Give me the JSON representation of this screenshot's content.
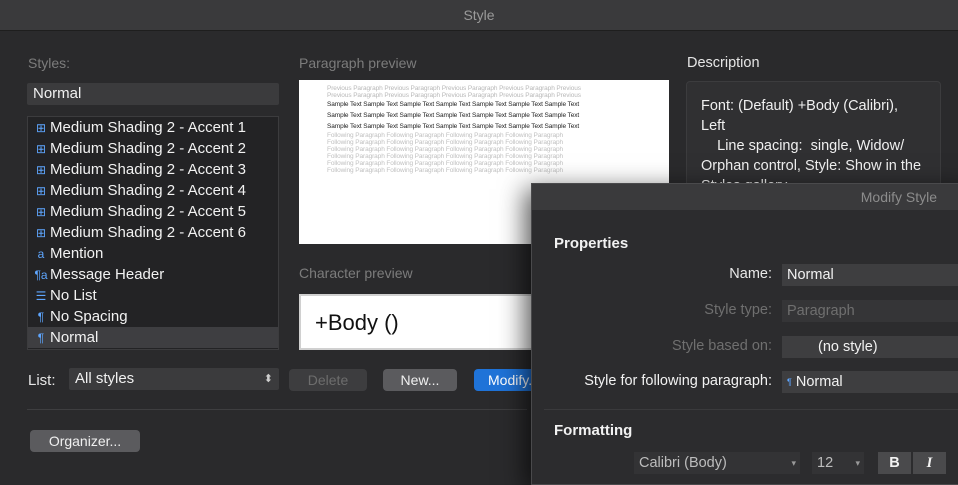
{
  "window": {
    "title": "Style"
  },
  "styles": {
    "label": "Styles:",
    "current": "Normal",
    "items": [
      {
        "icon": "⊞",
        "label": "Medium Shading 2 - Accent 1"
      },
      {
        "icon": "⊞",
        "label": "Medium Shading 2 - Accent 2"
      },
      {
        "icon": "⊞",
        "label": "Medium Shading 2 - Accent 3"
      },
      {
        "icon": "⊞",
        "label": "Medium Shading 2 - Accent 4"
      },
      {
        "icon": "⊞",
        "label": "Medium Shading 2 - Accent 5"
      },
      {
        "icon": "⊞",
        "label": "Medium Shading 2 - Accent 6"
      },
      {
        "icon": "a",
        "label": "Mention"
      },
      {
        "icon": "¶a",
        "label": "Message Header"
      },
      {
        "icon": "☰",
        "label": "No List"
      },
      {
        "icon": "¶",
        "label": "No Spacing"
      },
      {
        "icon": "¶",
        "label": "Normal"
      }
    ],
    "list_label": "List:",
    "list_value": "All styles"
  },
  "paragraph_preview": {
    "label": "Paragraph preview",
    "previous_text": "Previous Paragraph Previous Paragraph Previous Paragraph Previous Paragraph Previous",
    "sample_text": "Sample Text Sample Text Sample Text Sample Text Sample Text Sample Text Sample Text",
    "following_text": "Following Paragraph Following Paragraph Following Paragraph Following Paragraph"
  },
  "character_preview": {
    "label": "Character preview",
    "text": "+Body ()"
  },
  "description": {
    "label": "Description",
    "text": "Font: (Default) +Body (Calibri), Left\n    Line spacing:  single, Widow/ Orphan control, Style: Show in the Styles gallery"
  },
  "buttons": {
    "delete": "Delete",
    "new": "New...",
    "modify": "Modify...",
    "organizer": "Organizer..."
  },
  "modify_style": {
    "title": "Modify Style",
    "properties_label": "Properties",
    "name_label": "Name:",
    "name_value": "Normal",
    "style_type_label": "Style type:",
    "style_type_value": "Paragraph",
    "based_on_label": "Style based on:",
    "based_on_value": "(no style)",
    "following_label": "Style for following paragraph:",
    "following_value": "Normal",
    "formatting_label": "Formatting",
    "font": "Calibri (Body)",
    "size": "12",
    "bold": "B",
    "italic": "I"
  }
}
